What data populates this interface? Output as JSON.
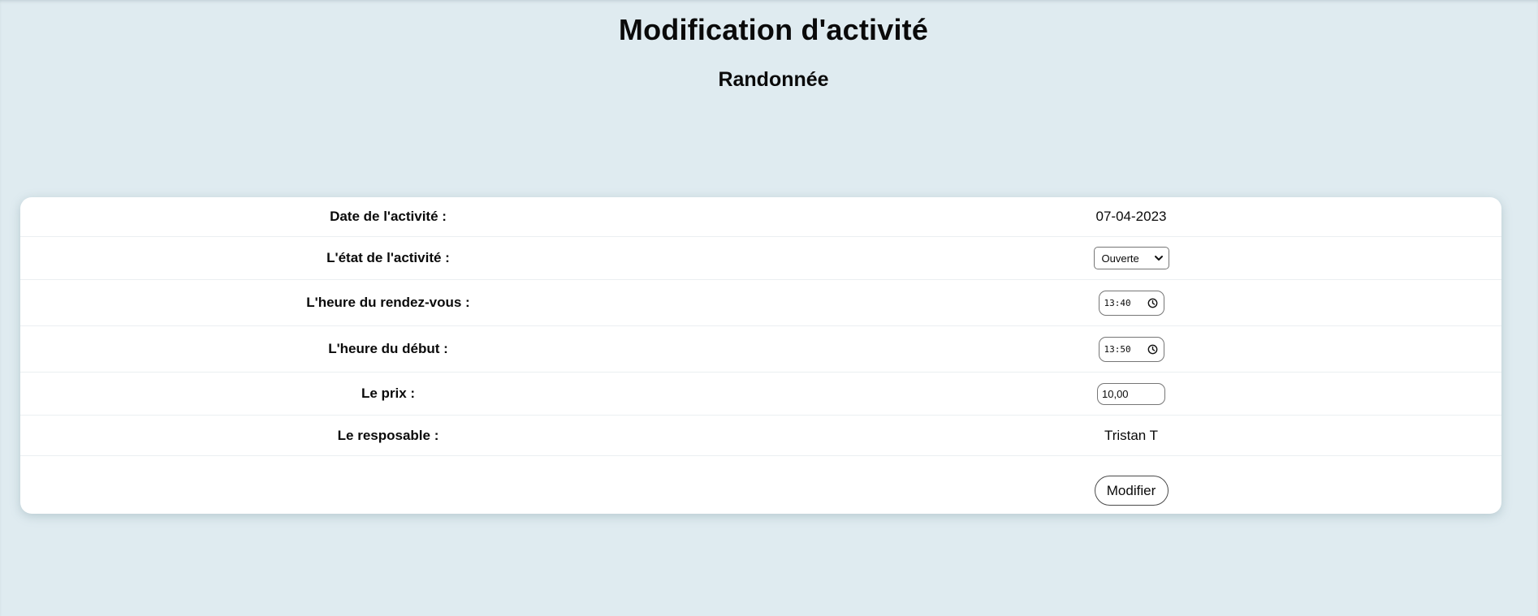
{
  "header": {
    "title": "Modification d'activité",
    "activity_name": "Randonnée"
  },
  "form": {
    "date": {
      "label": "Date de l'activité :",
      "value": "07-04-2023"
    },
    "state": {
      "label": "L'état de l'activité :",
      "selected": "Ouverte",
      "icon": "chevron-down-icon"
    },
    "meeting_time": {
      "label": "L'heure du rendez-vous :",
      "value": "13:40",
      "icon": "clock-icon"
    },
    "start_time": {
      "label": "L'heure du début :",
      "value": "13:50",
      "icon": "clock-icon"
    },
    "price": {
      "label": "Le prix :",
      "value": "10,00"
    },
    "manager": {
      "label": "Le resposable :",
      "value": "Tristan T"
    },
    "submit_label": "Modifier"
  },
  "colors": {
    "background": "#dfebf0",
    "card": "#ffffff",
    "text": "#0a0a0a",
    "border": "#767676"
  }
}
